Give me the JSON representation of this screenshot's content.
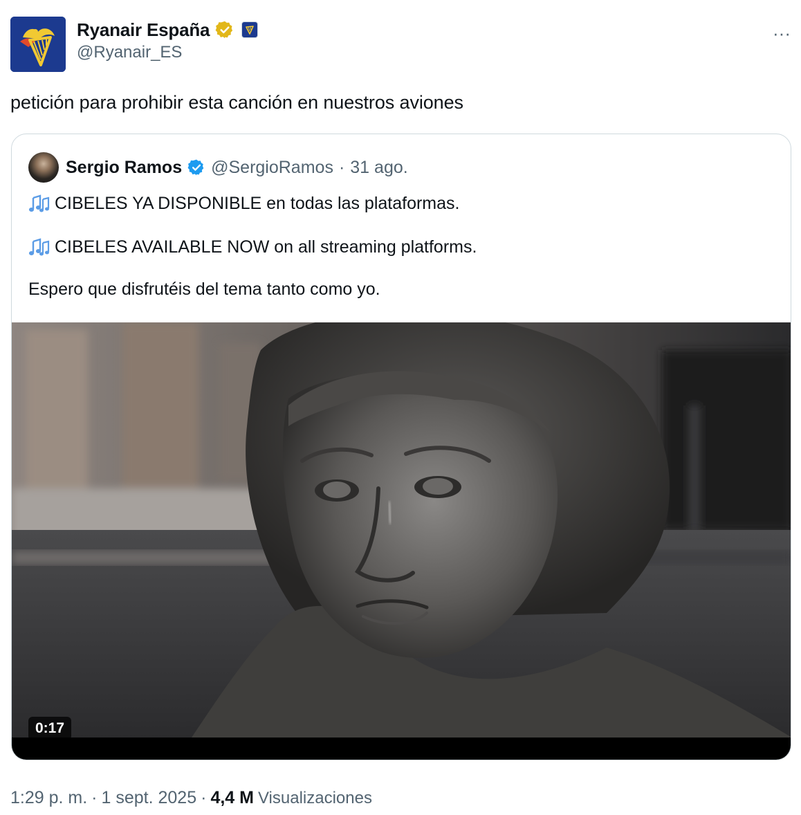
{
  "author": {
    "display_name": "Ryanair España",
    "handle": "@Ryanair_ES",
    "verified": "gold",
    "brand_color": "#1c3a8f"
  },
  "more_icon": "···",
  "tweet_text": "petición para prohibir esta canción en nuestros aviones",
  "quote": {
    "display_name": "Sergio Ramos",
    "handle": "@SergioRamos",
    "separator": "·",
    "date": "31 ago.",
    "verified": "blue",
    "lines": [
      "CIBELES YA DISPONIBLE en todas las plataformas.",
      "CIBELES AVAILABLE NOW on all streaming platforms.",
      "Espero que disfrutéis del tema tanto como yo."
    ],
    "video": {
      "duration": "0:17"
    }
  },
  "footer": {
    "time": "1:29 p. m.",
    "sep1": "·",
    "date": "1 sept. 2025",
    "sep2": "·",
    "views_count": "4,4 M",
    "views_label": "Visualizaciones"
  },
  "colors": {
    "text_primary": "#0f1419",
    "text_secondary": "#536471",
    "border": "#cfd9de",
    "verified_blue": "#1d9bf0",
    "verified_gold": "#e2b719"
  }
}
